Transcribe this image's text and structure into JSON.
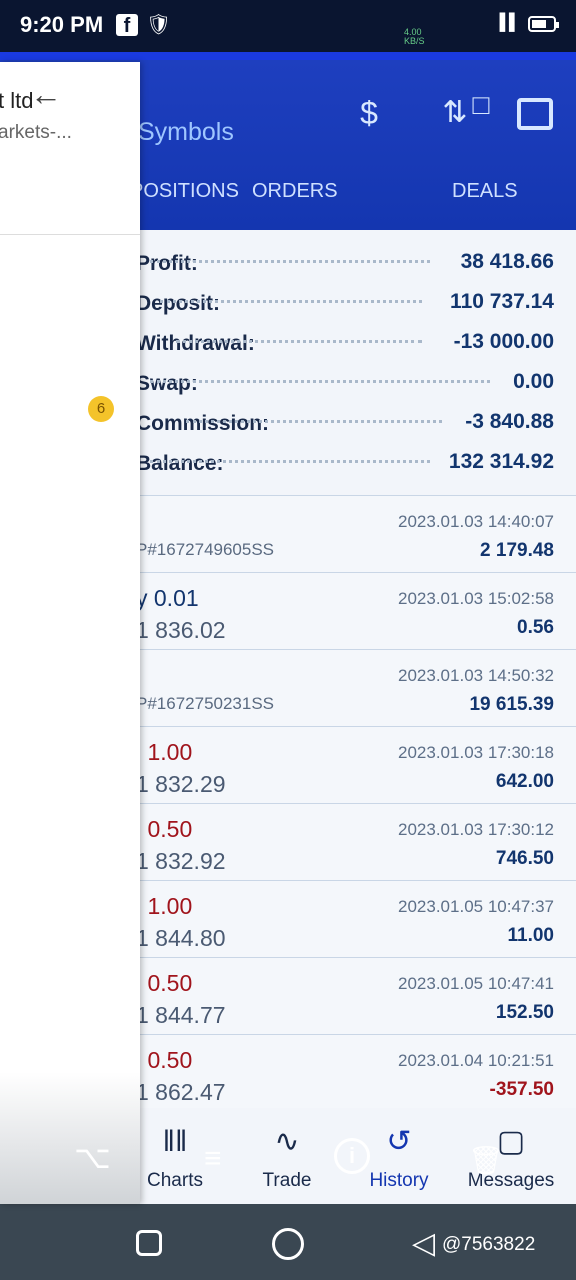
{
  "status_bar": {
    "time": "9:20 PM",
    "speed": "4.00\nKB/S",
    "battery": "43"
  },
  "header": {
    "title": "Symbols",
    "tabs": [
      {
        "label": "POSITIONS",
        "active": true
      },
      {
        "label": "ORDERS",
        "active": false
      },
      {
        "label": "DEALS",
        "active": false
      }
    ]
  },
  "summary": [
    {
      "label": "Profit:",
      "value": "38 418.66"
    },
    {
      "label": "Deposit:",
      "value": "110 737.14"
    },
    {
      "label": "Withdrawal:",
      "value": "-13 000.00"
    },
    {
      "label": "Swap:",
      "value": "0.00"
    },
    {
      "label": "Commission:",
      "value": "-3 840.88"
    },
    {
      "label": "Balance:",
      "value": "132 314.92"
    }
  ],
  "deals": [
    {
      "title": "",
      "sub": "P#1672749605SS",
      "time": "2023.01.03 14:40:07",
      "profit": "2 179.48",
      "side": "neutral"
    },
    {
      "title": "y 0.01",
      "sub": "1 836.02",
      "time": "2023.01.03 15:02:58",
      "profit": "0.56",
      "side": "buy"
    },
    {
      "title": "",
      "sub": "P#1672750231SS",
      "time": "2023.01.03 14:50:32",
      "profit": "19 615.39",
      "side": "neutral"
    },
    {
      "title": "l 1.00",
      "sub": "1 832.29",
      "time": "2023.01.03 17:30:18",
      "profit": "642.00",
      "side": "sell"
    },
    {
      "title": "l 0.50",
      "sub": "1 832.92",
      "time": "2023.01.03 17:30:12",
      "profit": "746.50",
      "side": "sell"
    },
    {
      "title": "l 1.00",
      "sub": "1 844.80",
      "time": "2023.01.05 10:47:37",
      "profit": "11.00",
      "side": "sell"
    },
    {
      "title": "l 0.50",
      "sub": "1 844.77",
      "time": "2023.01.05 10:47:41",
      "profit": "152.50",
      "side": "sell"
    },
    {
      "title": "l 0.50",
      "sub": "1 862.47",
      "time": "2023.01.04 10:21:51",
      "profit": "-357.50",
      "side": "sell"
    }
  ],
  "bottom_nav": {
    "charts": "Charts",
    "trade": "Trade",
    "history": "History",
    "messages": "Messages"
  },
  "drawer": {
    "title": "t ltd",
    "subtitle": "arkets-...",
    "badge": "6"
  },
  "watermark": "@7563822",
  "colors": {
    "header_blue": "#1436b0",
    "value_blue": "#12356e",
    "sell_red": "#a0141c",
    "badge_yellow": "#f4c32a"
  }
}
